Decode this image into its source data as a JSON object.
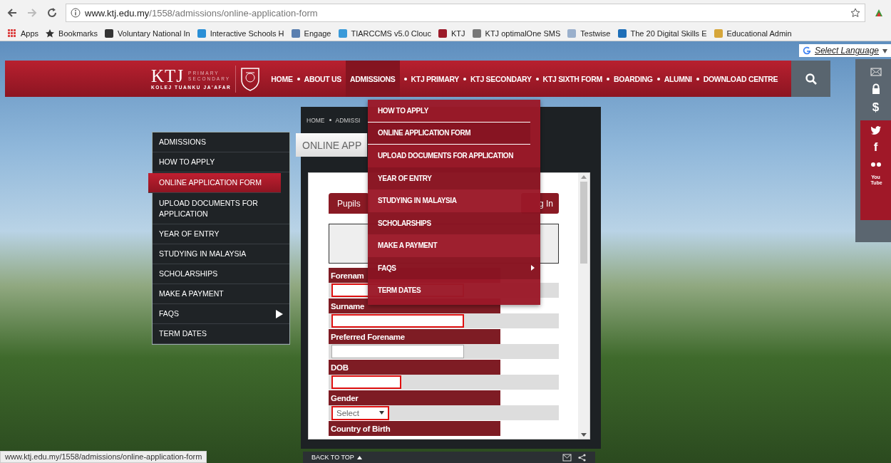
{
  "browser": {
    "url_host": "www.ktj.edu.my",
    "url_path": "/1558/admissions/online-application-form",
    "bookmarks": [
      {
        "label": "Apps",
        "kind": "apps"
      },
      {
        "label": "Bookmarks",
        "kind": "folder"
      },
      {
        "label": "Voluntary National In",
        "kind": "site",
        "color": "#333333"
      },
      {
        "label": "Interactive Schools H",
        "kind": "site",
        "color": "#2a8fd6"
      },
      {
        "label": "Engage",
        "kind": "site",
        "color": "#5a7fb0"
      },
      {
        "label": "TIARCCMS v5.0 Clouc",
        "kind": "site",
        "color": "#3a9ad9"
      },
      {
        "label": "KTJ",
        "kind": "site",
        "color": "#9b1b2a"
      },
      {
        "label": "KTJ optimalOne SMS",
        "kind": "site",
        "color": "#777777"
      },
      {
        "label": "Testwise",
        "kind": "site",
        "color": "#9ab0cc"
      },
      {
        "label": "The 20 Digital Skills E",
        "kind": "site",
        "color": "#1e6fb8"
      },
      {
        "label": "Educational Admin",
        "kind": "site",
        "color": "#d6a63a"
      }
    ],
    "status_url": "www.ktj.edu.my/1558/admissions/online-application-form"
  },
  "language": {
    "label": "Select Language"
  },
  "logo": {
    "initials": "KTJ",
    "line_1": "PRIMARY",
    "line_2": "SECONDARY",
    "full_name": "KOLEJ TUANKU JA'AFAR"
  },
  "nav": [
    {
      "label": "HOME",
      "selected": false
    },
    {
      "label": "ABOUT US",
      "selected": false
    },
    {
      "label": "ADMISSIONS",
      "selected": true
    },
    {
      "label": "KTJ PRIMARY",
      "selected": false
    },
    {
      "label": "KTJ SECONDARY",
      "selected": false
    },
    {
      "label": "KTJ SIXTH FORM",
      "selected": false
    },
    {
      "label": "BOARDING",
      "selected": false
    },
    {
      "label": "ALUMNI",
      "selected": false
    },
    {
      "label": "DOWNLOAD CENTRE",
      "selected": false
    }
  ],
  "social": [
    {
      "kind": "mail"
    },
    {
      "kind": "lock"
    },
    {
      "kind": "dollar",
      "glyph": "$"
    },
    {
      "kind": "twitter"
    },
    {
      "kind": "facebook",
      "glyph": "f"
    },
    {
      "kind": "flickr"
    },
    {
      "kind": "youtube",
      "glyph": "You Tube"
    }
  ],
  "side_menu": [
    {
      "label": "ADMISSIONS",
      "selected": false,
      "has_submenu": false
    },
    {
      "label": "HOW TO APPLY",
      "selected": false,
      "has_submenu": false
    },
    {
      "label": "ONLINE APPLICATION FORM",
      "selected": true,
      "has_submenu": false
    },
    {
      "label": "UPLOAD DOCUMENTS FOR APPLICATION",
      "selected": false,
      "has_submenu": false
    },
    {
      "label": "YEAR OF ENTRY",
      "selected": false,
      "has_submenu": false
    },
    {
      "label": "STUDYING IN MALAYSIA",
      "selected": false,
      "has_submenu": false
    },
    {
      "label": "SCHOLARSHIPS",
      "selected": false,
      "has_submenu": false
    },
    {
      "label": "MAKE A PAYMENT",
      "selected": false,
      "has_submenu": false
    },
    {
      "label": "FAQS",
      "selected": false,
      "has_submenu": true
    },
    {
      "label": "TERM DATES",
      "selected": false,
      "has_submenu": false
    }
  ],
  "breadcrumb": [
    "HOME",
    "ADMISSI"
  ],
  "page_title": "ONLINE APP",
  "form": {
    "tabs": [
      {
        "label": "Pupils",
        "selected": true
      }
    ],
    "login_label": "g In",
    "fields": [
      {
        "label": "Forenam",
        "kind": "text",
        "required": true
      },
      {
        "label": "Surname",
        "kind": "text",
        "required": true
      },
      {
        "label": "Preferred Forename",
        "kind": "text",
        "required": false
      },
      {
        "label": "DOB",
        "kind": "date",
        "required": true
      },
      {
        "label": "Gender",
        "kind": "select",
        "required": true,
        "value": "Select"
      },
      {
        "label": "Country of Birth",
        "kind": "none"
      }
    ]
  },
  "dropdown": [
    {
      "label": "HOW TO APPLY",
      "divider": true,
      "has_submenu": false
    },
    {
      "label": "ONLINE APPLICATION FORM",
      "divider": true,
      "has_submenu": false
    },
    {
      "label": "UPLOAD DOCUMENTS FOR APPLICATION",
      "divider": false,
      "has_submenu": false
    },
    {
      "label": "YEAR OF ENTRY",
      "divider": false,
      "has_submenu": false
    },
    {
      "label": "STUDYING IN MALAYSIA",
      "divider": false,
      "has_submenu": false
    },
    {
      "label": "SCHOLARSHIPS",
      "divider": false,
      "has_submenu": false
    },
    {
      "label": "MAKE A PAYMENT",
      "divider": false,
      "has_submenu": false
    },
    {
      "label": "FAQS",
      "divider": false,
      "has_submenu": true
    },
    {
      "label": "TERM DATES",
      "divider": false,
      "has_submenu": false
    }
  ],
  "back_to_top": "BACK TO TOP"
}
